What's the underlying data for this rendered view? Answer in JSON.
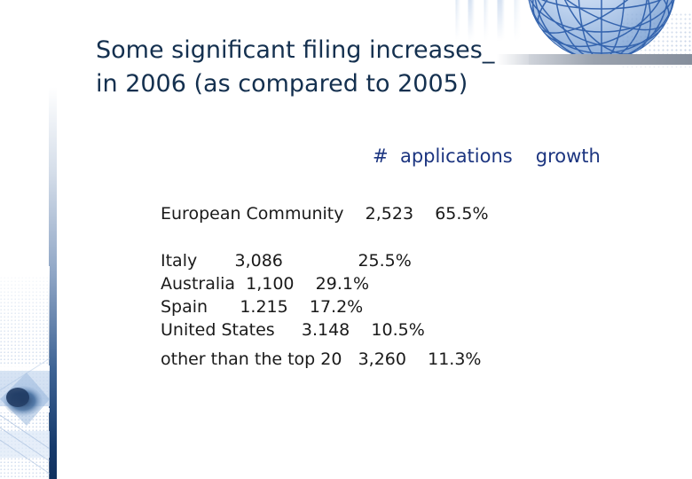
{
  "slide": {
    "title": "Some significant filing increases_\nin 2006 (as compared to 2005)",
    "title_color": "#14304f",
    "header_color": "#1c3580",
    "body_color": "#1a1a1a",
    "background_color": "#ffffff"
  },
  "table": {
    "headers": {
      "label_col": "",
      "applications": "#  applications",
      "growth": "growth"
    },
    "rows": [
      {
        "label": "European Community",
        "applications": "2,523",
        "growth": "65.5%"
      },
      {
        "label": "Italy",
        "applications": "3,086",
        "growth": "25.5%"
      },
      {
        "label": "Australia",
        "applications": "1,100",
        "growth": "29.1%"
      },
      {
        "label": "Spain",
        "applications": "1.215",
        "growth": "17.2%"
      },
      {
        "label": "United States",
        "applications": "3.148",
        "growth": "10.5%"
      },
      {
        "label": "other than the top 20",
        "applications": "3,260",
        "growth": "11.3%"
      }
    ],
    "lines": {
      "european_community": "European Community    2,523    65.5%",
      "italy": "Italy       3,086              25.5%",
      "australia": "Australia  1,100    29.1%",
      "spain": "Spain      1.215    17.2%",
      "united_states": "United States     3.148    10.5%",
      "other": "other than the top 20   3,260    11.3%"
    }
  },
  "decor": {
    "globe": "wireframe-globe-graphic",
    "dot_grid": "halftone-dot-pattern",
    "gray_bar": "horizontal-gray-gradient-bar",
    "left_bar": "vertical-blue-gradient-bar",
    "bottom_left_art": "abstract-blue-graphic",
    "globe_color": "#2f5fab",
    "bar_gradient_end": "#10305e"
  }
}
